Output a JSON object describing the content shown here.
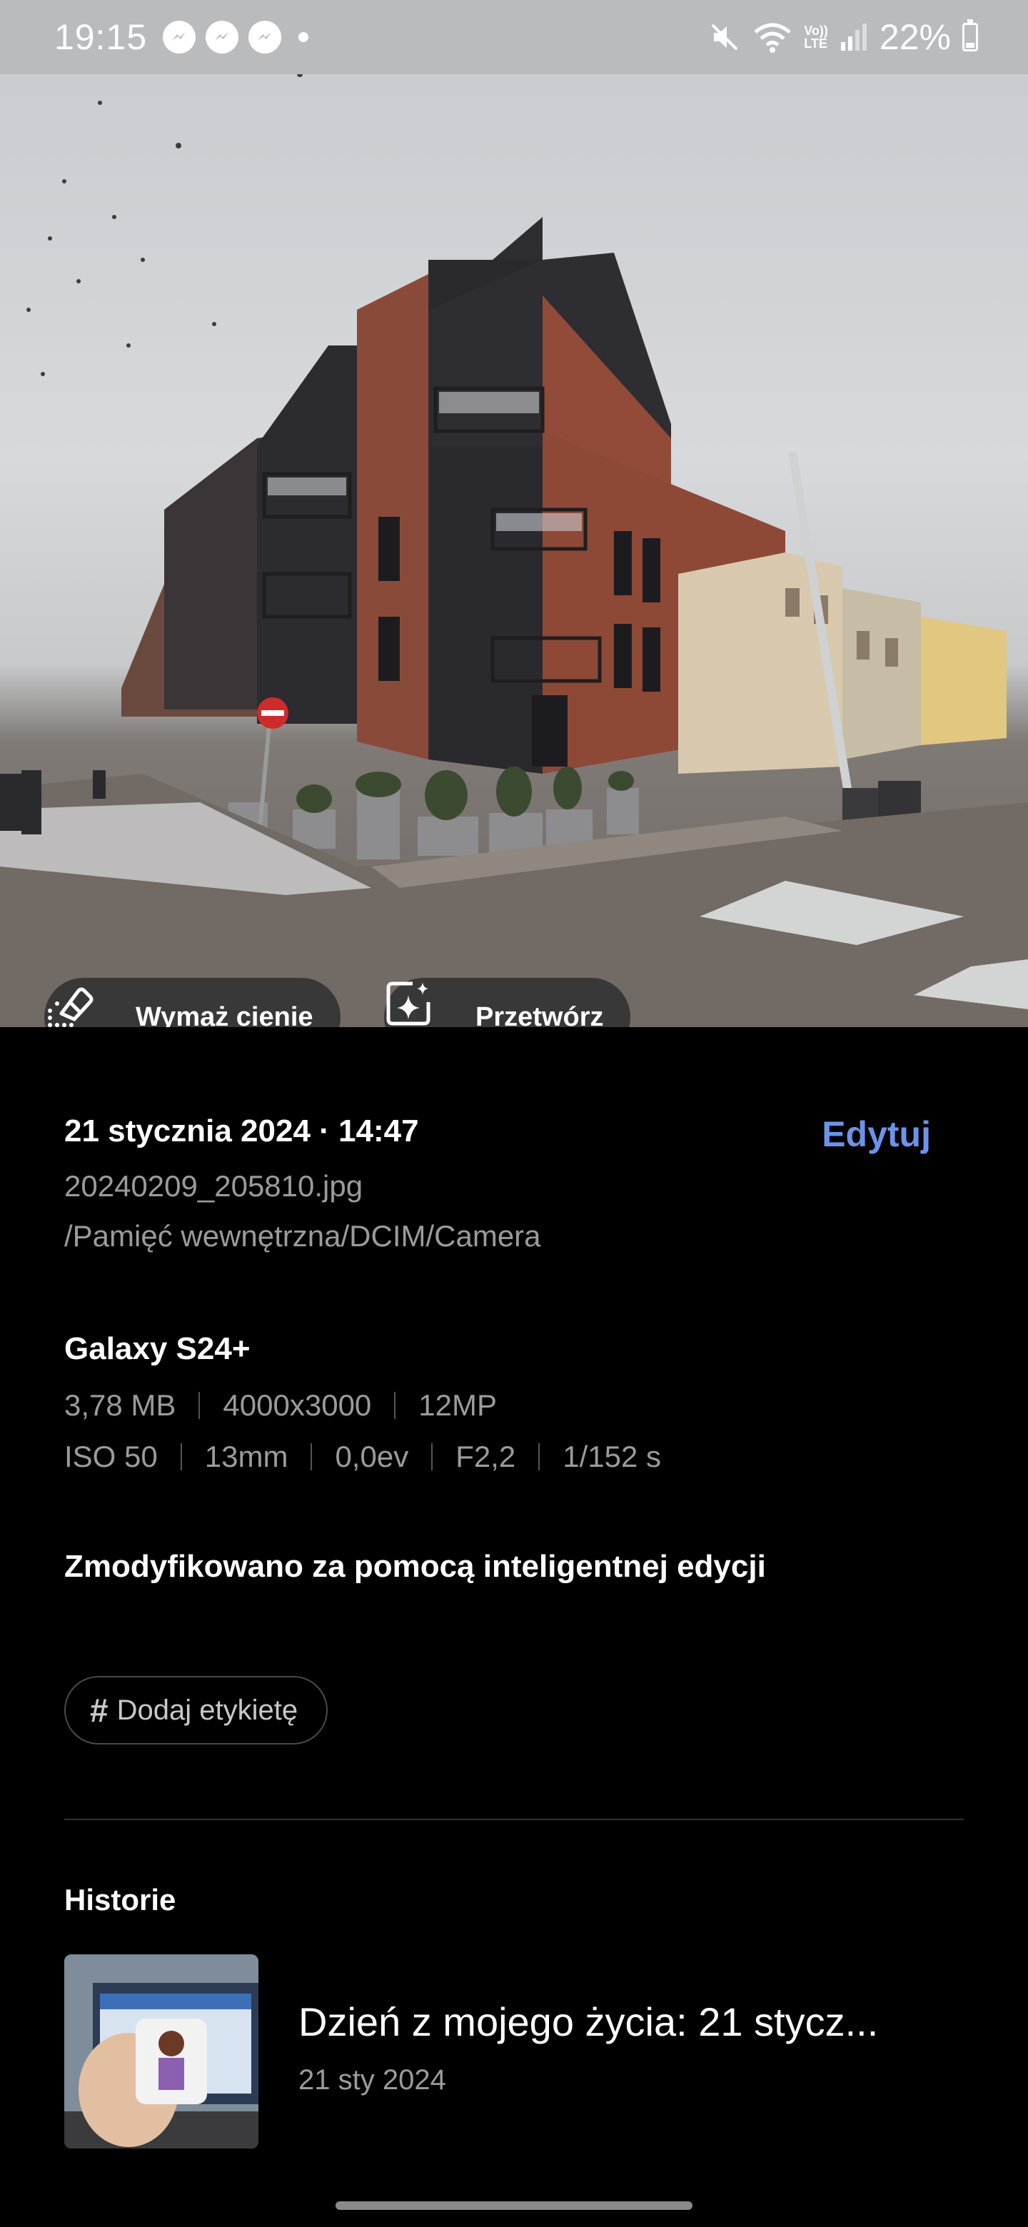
{
  "status_bar": {
    "time": "19:15",
    "battery": "22%",
    "volte_top": "Vo))",
    "volte_bottom": "LTE",
    "icons": [
      "messenger-icon",
      "messenger-icon",
      "messenger-icon",
      "notification-dot",
      "mute-icon",
      "wifi-icon",
      "volte-icon",
      "signal-icon",
      "battery-icon"
    ]
  },
  "photo_actions": {
    "erase_shadows": "Wymaż cienie",
    "remaster": "Przetwórz"
  },
  "details": {
    "date": "21 stycznia 2024 · 14:47",
    "edit_label": "Edytuj",
    "filename": "20240209_205810.jpg",
    "path": "/Pamięć wewnętrzna/DCIM/Camera",
    "device": "Galaxy S24+",
    "specs_row1": [
      "3,78 MB",
      "4000x3000",
      "12MP"
    ],
    "specs_row2": [
      "ISO 50",
      "13mm",
      "0,0ev",
      "F2,2",
      "1/152 s"
    ],
    "modified_note": "Zmodyfikowano za pomocą inteligentnej edycji",
    "add_tag": "Dodaj etykietę",
    "add_tag_symbol": "#"
  },
  "stories": {
    "heading": "Historie",
    "items": [
      {
        "title": "Dzień z mojego życia: 21 stycz...",
        "date": "21 sty 2024"
      }
    ]
  },
  "colors": {
    "accent": "#6c93ea",
    "background": "#000000",
    "secondary_text": "#9b9b9b"
  }
}
